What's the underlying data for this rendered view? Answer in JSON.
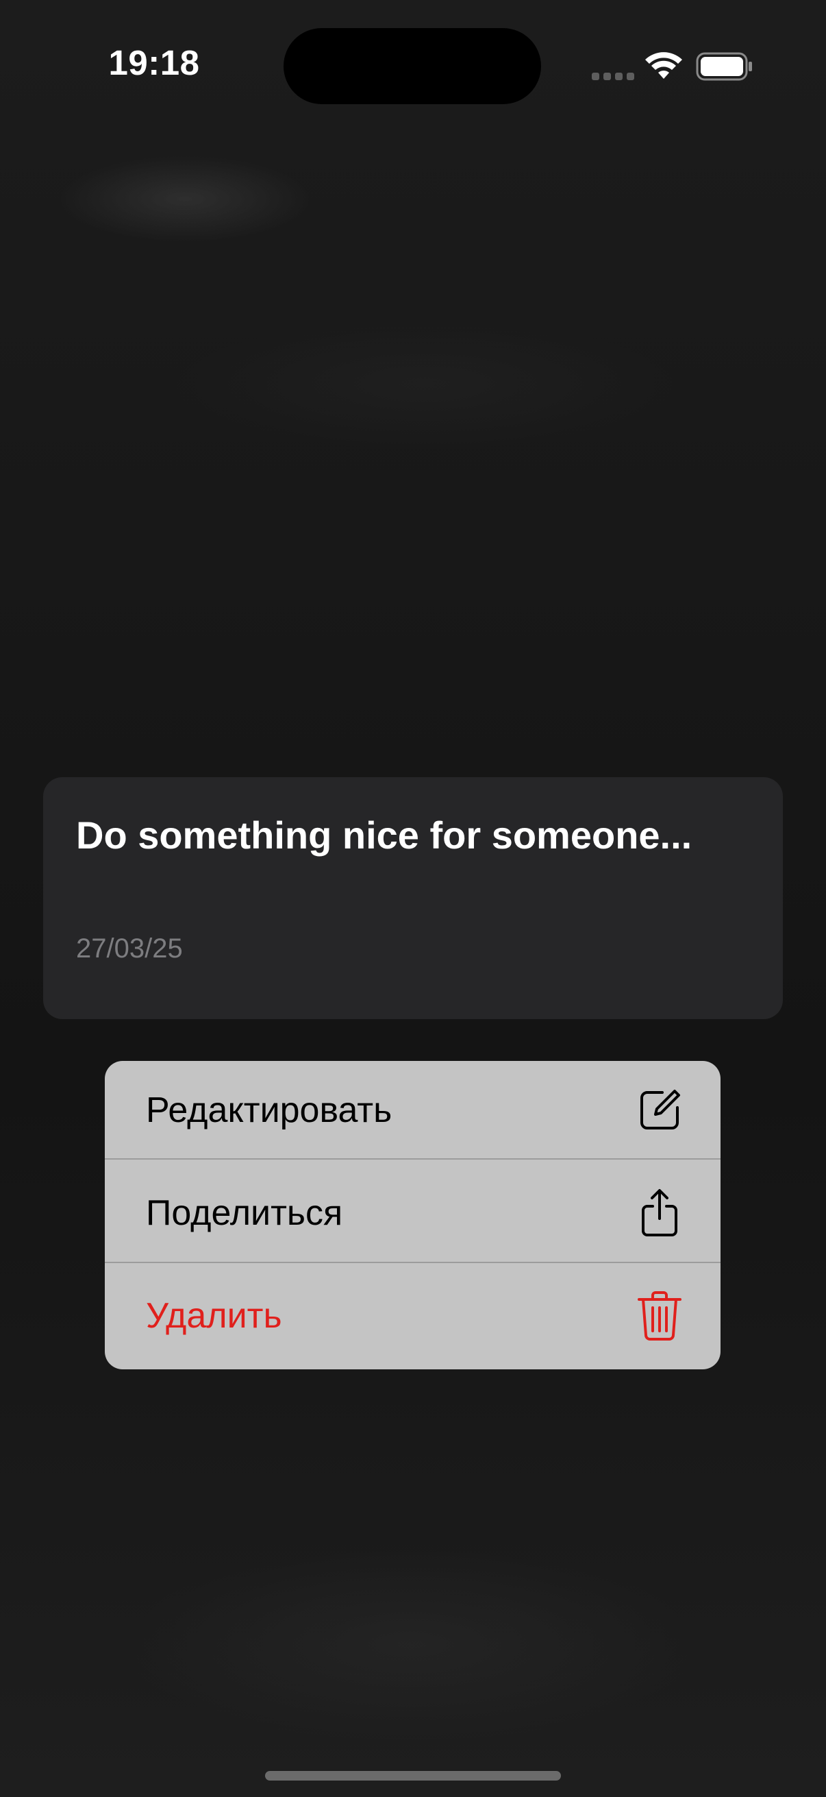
{
  "status_bar": {
    "time": "19:18",
    "icons": [
      "cellular-signal-icon",
      "wifi-icon",
      "battery-icon"
    ]
  },
  "note": {
    "title": "Do something nice for someone...",
    "date": "27/03/25"
  },
  "context_menu": {
    "items": [
      {
        "label": "Редактировать",
        "icon": "edit-icon",
        "destructive": false
      },
      {
        "label": "Поделиться",
        "icon": "share-icon",
        "destructive": false
      },
      {
        "label": "Удалить",
        "icon": "trash-icon",
        "destructive": true
      }
    ]
  },
  "colors": {
    "background": "#1a1a1a",
    "card": "#262628",
    "menu_background": "#c4c4c4",
    "destructive": "#e0201c",
    "date_text": "#7d7d80"
  }
}
